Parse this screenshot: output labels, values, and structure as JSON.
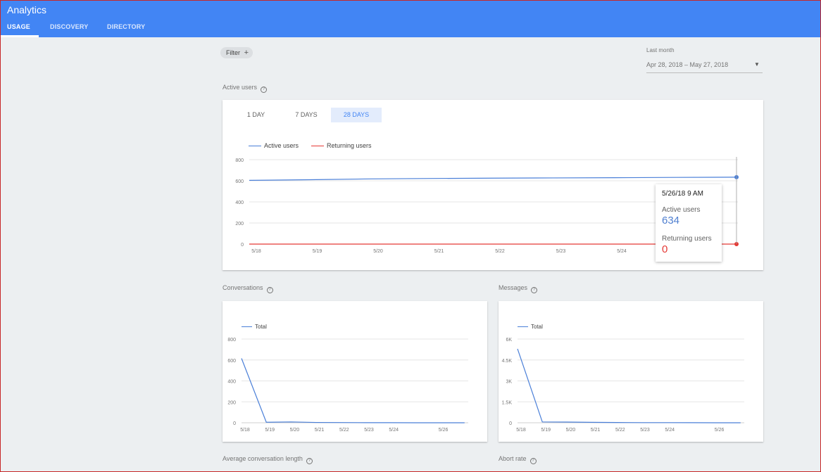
{
  "app": {
    "title": "Analytics"
  },
  "tabs": [
    {
      "label": "USAGE",
      "active": true
    },
    {
      "label": "DISCOVERY",
      "active": false
    },
    {
      "label": "DIRECTORY",
      "active": false
    }
  ],
  "filter": {
    "label": "Filter",
    "icon": "plus-icon"
  },
  "date_picker": {
    "label": "Last month",
    "value": "Apr 28, 2018 – May 27, 2018",
    "icon": "caret-down-icon"
  },
  "active_users": {
    "title": "Active users",
    "help_icon": "help-icon",
    "range_tabs": [
      {
        "label": "1 DAY",
        "active": false
      },
      {
        "label": "7 DAYS",
        "active": false
      },
      {
        "label": "28 DAYS",
        "active": true
      }
    ],
    "legend": [
      {
        "label": "Active users",
        "color": "#4a7fd8"
      },
      {
        "label": "Returning users",
        "color": "#e53935"
      }
    ],
    "tooltip": {
      "date": "5/26/18 9 AM",
      "active_label": "Active users",
      "active_value": "634",
      "returning_label": "Returning users",
      "returning_value": "0"
    }
  },
  "conversations": {
    "title": "Conversations",
    "legend": "Total"
  },
  "messages": {
    "title": "Messages",
    "legend": "Total"
  },
  "avg_conversation_length": {
    "title": "Average conversation length"
  },
  "abort_rate": {
    "title": "Abort rate"
  },
  "chart_data": [
    {
      "type": "line",
      "title": "Active users",
      "x": [
        "5/18",
        "5/19",
        "5/20",
        "5/21",
        "5/22",
        "5/23",
        "5/24",
        "5/25",
        "5/26"
      ],
      "tick_labels": [
        "5/18",
        "5/19",
        "5/20",
        "5/21",
        "5/22",
        "5/23",
        "5/24"
      ],
      "series": [
        {
          "name": "Active users",
          "color": "#4a7fd8",
          "values": [
            604,
            610,
            618,
            622,
            625,
            627,
            629,
            632,
            634
          ]
        },
        {
          "name": "Returning users",
          "color": "#e53935",
          "values": [
            0,
            0,
            0,
            0,
            0,
            0,
            0,
            0,
            0
          ]
        }
      ],
      "yticks": [
        "0",
        "200",
        "400",
        "600",
        "800"
      ],
      "ylim": [
        0,
        800
      ],
      "grid": true,
      "legend": "top-left"
    },
    {
      "type": "line",
      "title": "Conversations",
      "x": [
        "5/18",
        "5/19",
        "5/20",
        "5/21",
        "5/22",
        "5/23",
        "5/24",
        "5/25",
        "5/26",
        "5/27"
      ],
      "tick_labels": [
        "5/18",
        "5/19",
        "5/20",
        "5/21",
        "5/22",
        "5/23",
        "5/24",
        "5/26"
      ],
      "series": [
        {
          "name": "Total",
          "color": "#4a7fd8",
          "values": [
            615,
            5,
            8,
            3,
            2,
            1,
            1,
            0,
            0,
            0
          ]
        }
      ],
      "yticks": [
        "0",
        "200",
        "400",
        "600",
        "800"
      ],
      "ylim": [
        0,
        800
      ],
      "grid": true,
      "legend": "top-left"
    },
    {
      "type": "line",
      "title": "Messages",
      "x": [
        "5/18",
        "5/19",
        "5/20",
        "5/21",
        "5/22",
        "5/23",
        "5/24",
        "5/25",
        "5/26",
        "5/27"
      ],
      "tick_labels": [
        "5/18",
        "5/19",
        "5/20",
        "5/21",
        "5/22",
        "5/23",
        "5/24",
        "5/26"
      ],
      "series": [
        {
          "name": "Total",
          "color": "#4a7fd8",
          "values": [
            5300,
            60,
            50,
            30,
            20,
            10,
            10,
            5,
            0,
            0
          ]
        }
      ],
      "yticks": [
        "0",
        "1.5K",
        "3K",
        "4.5K",
        "6K"
      ],
      "ylim": [
        0,
        6000
      ],
      "grid": true,
      "legend": "top-left"
    }
  ]
}
